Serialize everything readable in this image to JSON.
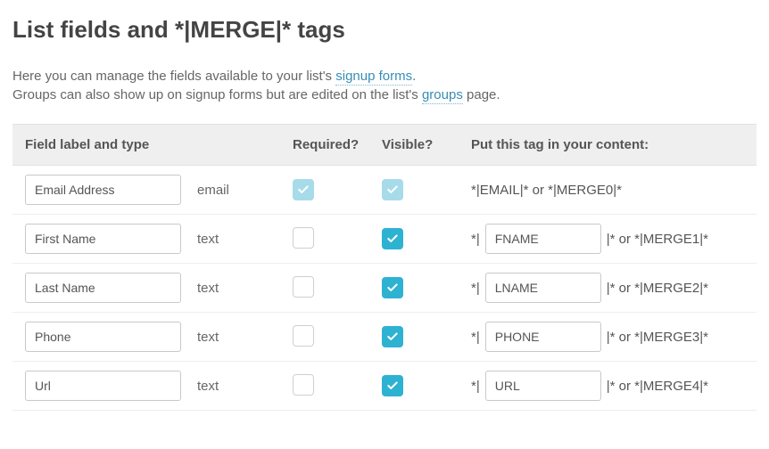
{
  "title": "List fields and *|MERGE|* tags",
  "intro": {
    "line1_a": "Here you can manage the fields available to your list's ",
    "link1": "signup forms",
    "line1_b": ".",
    "line2_a": "Groups can also show up on signup forms but are edited on the list's ",
    "link2": "groups",
    "line2_b": " page."
  },
  "headers": {
    "field": "Field label and type",
    "required": "Required?",
    "visible": "Visible?",
    "tag": "Put this tag in your content:"
  },
  "rows": [
    {
      "label": "Email Address",
      "type": "email",
      "required": true,
      "required_locked": true,
      "visible": true,
      "visible_locked": true,
      "tag_editable": false,
      "tag_display": "*|EMAIL|* or *|MERGE0|*"
    },
    {
      "label": "First Name",
      "type": "text",
      "required": false,
      "required_locked": false,
      "visible": true,
      "visible_locked": false,
      "tag_editable": true,
      "tag_prefix": "*|",
      "tag_value": "FNAME",
      "tag_suffix": "|* or *|MERGE1|*"
    },
    {
      "label": "Last Name",
      "type": "text",
      "required": false,
      "required_locked": false,
      "visible": true,
      "visible_locked": false,
      "tag_editable": true,
      "tag_prefix": "*|",
      "tag_value": "LNAME",
      "tag_suffix": "|* or *|MERGE2|*"
    },
    {
      "label": "Phone",
      "type": "text",
      "required": false,
      "required_locked": false,
      "visible": true,
      "visible_locked": false,
      "tag_editable": true,
      "tag_prefix": "*|",
      "tag_value": "PHONE",
      "tag_suffix": "|* or *|MERGE3|*"
    },
    {
      "label": "Url",
      "type": "text",
      "required": false,
      "required_locked": false,
      "visible": true,
      "visible_locked": false,
      "tag_editable": true,
      "tag_prefix": "*|",
      "tag_value": "URL",
      "tag_suffix": "|* or *|MERGE4|*"
    }
  ]
}
